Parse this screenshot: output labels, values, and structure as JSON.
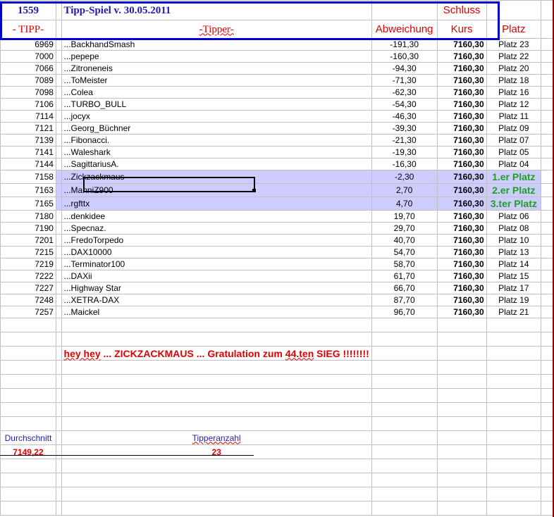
{
  "header": {
    "id": "1559",
    "title": "Tipp-Spiel v. 30.05.2011",
    "schluss": "Schluss",
    "col_tipp": "- TIPP-",
    "col_tipper": "-Tipper-",
    "col_abw": "Abweichung",
    "col_kurs": "Kurs",
    "col_platz": "Platz"
  },
  "rows": [
    {
      "tipp": "6969",
      "name": "...BackhandSmash",
      "abw": "-191,30",
      "kurs": "7160,30",
      "platz": "Platz 23"
    },
    {
      "tipp": "7000",
      "name": "...pepepe",
      "abw": "-160,30",
      "kurs": "7160,30",
      "platz": "Platz 22"
    },
    {
      "tipp": "7066",
      "name": "...Zitroneneis",
      "abw": "-94,30",
      "kurs": "7160,30",
      "platz": "Platz 20"
    },
    {
      "tipp": "7089",
      "name": "...ToMeister",
      "abw": "-71,30",
      "kurs": "7160,30",
      "platz": "Platz 18"
    },
    {
      "tipp": "7098",
      "name": "...Colea",
      "abw": "-62,30",
      "kurs": "7160,30",
      "platz": "Platz 16"
    },
    {
      "tipp": "7106",
      "name": "...TURBO_BULL",
      "abw": "-54,30",
      "kurs": "7160,30",
      "platz": "Platz 12"
    },
    {
      "tipp": "7114",
      "name": "...jocyx",
      "abw": "-46,30",
      "kurs": "7160,30",
      "platz": "Platz 11"
    },
    {
      "tipp": "7121",
      "name": "...Georg_Büchner",
      "abw": "-39,30",
      "kurs": "7160,30",
      "platz": "Platz 09"
    },
    {
      "tipp": "7139",
      "name": "...Fibonacci.",
      "abw": "-21,30",
      "kurs": "7160,30",
      "platz": "Platz 07"
    },
    {
      "tipp": "7141",
      "name": "...Waleshark",
      "abw": "-19,30",
      "kurs": "7160,30",
      "platz": "Platz 05"
    },
    {
      "tipp": "7144",
      "name": "...SagittariusA.",
      "abw": "-16,30",
      "kurs": "7160,30",
      "platz": "Platz 04"
    },
    {
      "tipp": "7158",
      "name": "...Zickzackmaus",
      "abw": "-2,30",
      "kurs": "7160,30",
      "platz": "1.er Platz",
      "winner": true
    },
    {
      "tipp": "7163",
      "name": "...ManniZ900",
      "abw": "2,70",
      "kurs": "7160,30",
      "platz": "2.er Platz",
      "winner": true
    },
    {
      "tipp": "7165",
      "name": "...rgfttx",
      "abw": "4,70",
      "kurs": "7160,30",
      "platz": "3.ter Platz",
      "winner": true
    },
    {
      "tipp": "7180",
      "name": "...denkidee",
      "abw": "19,70",
      "kurs": "7160,30",
      "platz": "Platz 06"
    },
    {
      "tipp": "7190",
      "name": "...Specnaz.",
      "abw": "29,70",
      "kurs": "7160,30",
      "platz": "Platz 08"
    },
    {
      "tipp": "7201",
      "name": "...FredoTorpedo",
      "abw": "40,70",
      "kurs": "7160,30",
      "platz": "Platz 10"
    },
    {
      "tipp": "7215",
      "name": "...DAX10000",
      "abw": "54,70",
      "kurs": "7160,30",
      "platz": "Platz 13"
    },
    {
      "tipp": "7219",
      "name": "...Terminator100",
      "abw": "58,70",
      "kurs": "7160,30",
      "platz": "Platz 14"
    },
    {
      "tipp": "7222",
      "name": "...DAXii",
      "abw": "61,70",
      "kurs": "7160,30",
      "platz": "Platz 15"
    },
    {
      "tipp": "7227",
      "name": "...Highway Star",
      "abw": "66,70",
      "kurs": "7160,30",
      "platz": "Platz 17"
    },
    {
      "tipp": "7248",
      "name": "...XETRA-DAX",
      "abw": "87,70",
      "kurs": "7160,30",
      "platz": "Platz 19"
    },
    {
      "tipp": "7257",
      "name": "...Maickel",
      "abw": "96,70",
      "kurs": "7160,30",
      "platz": "Platz 21"
    }
  ],
  "message": {
    "hey": "hey hey",
    "text": " ... ZICKZACKMAUS ... Gratulation zum ",
    "ten": "44.ten",
    "end": " SIEG !!!!!!!!"
  },
  "summary": {
    "avg_label": "Durchschnitt",
    "avg_value": "7149,22",
    "count_label": "Tipperanzahl",
    "count_value": "23"
  }
}
